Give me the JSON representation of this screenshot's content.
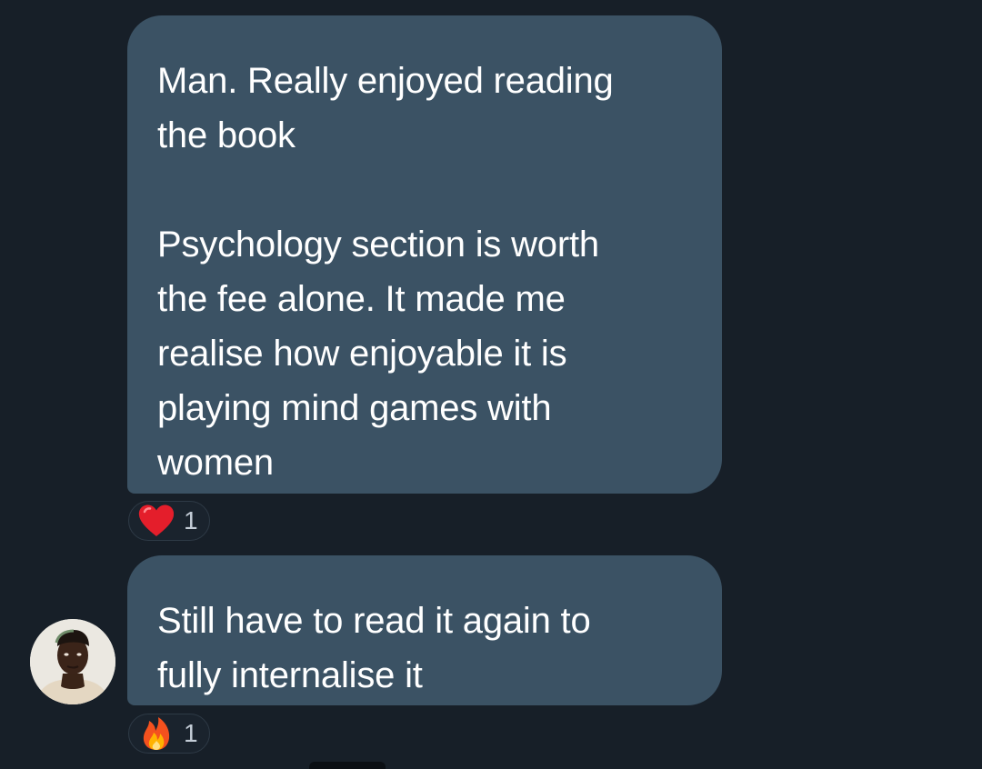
{
  "messages": [
    {
      "paragraphs": [
        "Man. Really enjoyed reading\nthe book",
        "Psychology section is worth\nthe fee alone. It made me\nrealise how enjoyable it is\nplaying mind games with\nwomen"
      ],
      "reaction": {
        "emoji": "heart-emoji",
        "count": "1"
      }
    },
    {
      "paragraphs": [
        "Still have to read it again to\nfully internalise it"
      ],
      "reaction": {
        "emoji": "fire-emoji",
        "count": "1"
      }
    }
  ],
  "colors": {
    "background": "#171f28",
    "bubble": "#3b5264",
    "text": "#ffffff",
    "reaction_count": "#c3ccd6"
  }
}
